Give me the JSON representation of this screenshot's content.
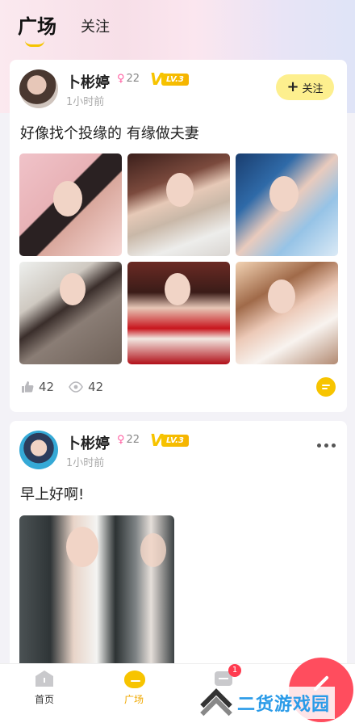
{
  "top_tabs": [
    {
      "label": "广场",
      "active": true
    },
    {
      "label": "关注",
      "active": false
    }
  ],
  "posts": [
    {
      "author": "卜彬婷",
      "gender_icon": "female-icon",
      "age": "22",
      "level": "LV.3",
      "time": "1小时前",
      "action": "关注",
      "text": "好像找个投缘的 有缘做夫妻",
      "photo_count": 6,
      "likes": "42",
      "views": "42"
    },
    {
      "author": "卜彬婷",
      "gender_icon": "female-icon",
      "age": "22",
      "level": "LV.3",
      "time": "1小时前",
      "text": "早上好啊!",
      "photo_count": 1
    }
  ],
  "bottom_nav": [
    {
      "label": "首页",
      "icon": "home-icon",
      "active": false
    },
    {
      "label": "广场",
      "icon": "square-icon",
      "active": true
    },
    {
      "label": "",
      "icon": "message-icon",
      "badge": "1",
      "active": false
    }
  ],
  "watermark": {
    "text": "二货游戏园"
  },
  "colors": {
    "accent": "#f7c400",
    "follow_bg": "#fdef8e",
    "fab": "#ff4d5e",
    "badge": "#ff3b4f"
  }
}
